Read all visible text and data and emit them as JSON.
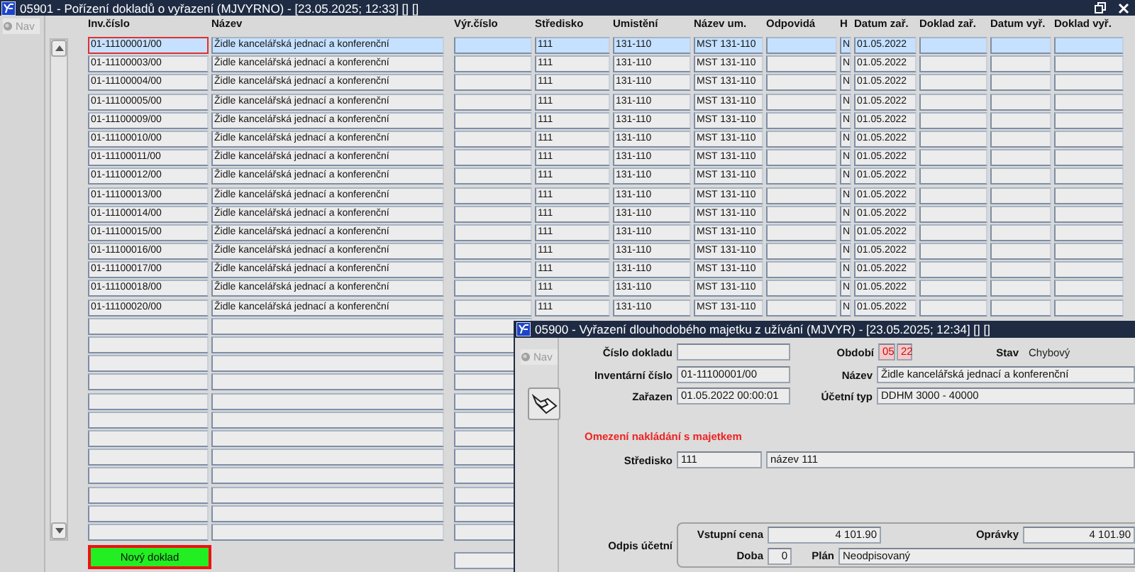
{
  "main_window": {
    "title": "05901 - Pořízení dokladů o vyřazení (MJVYRNO) - [23.05.2025; 12:33] [] []",
    "nav_label": "Nav",
    "columns": [
      "Inv.číslo",
      "Název",
      "Výr.číslo",
      "Středisko",
      "Umistění",
      "Název um.",
      "Odpovidá",
      "H",
      "Datum zař.",
      "Doklad zař.",
      "Datum vyř.",
      "Doklad vyř."
    ],
    "rows": [
      {
        "inv": "01-11100001/00",
        "name": "Židle kancelářská jednací a konferenční",
        "stredisko": "111",
        "umisteni": "131-110",
        "nazev_um": "MST 131-110",
        "h": "N",
        "datum_zar": "01.05.2022",
        "selected": true,
        "focused": true
      },
      {
        "inv": "01-11100003/00",
        "name": "Židle kancelářská jednací a konferenční",
        "stredisko": "111",
        "umisteni": "131-110",
        "nazev_um": "MST 131-110",
        "h": "N",
        "datum_zar": "01.05.2022",
        "selected": false,
        "focused": false
      },
      {
        "inv": "01-11100004/00",
        "name": "Židle kancelářská jednací a konferenční",
        "stredisko": "111",
        "umisteni": "131-110",
        "nazev_um": "MST 131-110",
        "h": "N",
        "datum_zar": "01.05.2022",
        "selected": false,
        "focused": false
      },
      {
        "inv": "01-11100005/00",
        "name": "Židle kancelářská jednací a konferenční",
        "stredisko": "111",
        "umisteni": "131-110",
        "nazev_um": "MST 131-110",
        "h": "N",
        "datum_zar": "01.05.2022",
        "selected": false,
        "focused": false
      },
      {
        "inv": "01-11100009/00",
        "name": "Židle kancelářská jednací a konferenční",
        "stredisko": "111",
        "umisteni": "131-110",
        "nazev_um": "MST 131-110",
        "h": "N",
        "datum_zar": "01.05.2022",
        "selected": false,
        "focused": false
      },
      {
        "inv": "01-11100010/00",
        "name": "Židle kancelářská jednací a konferenční",
        "stredisko": "111",
        "umisteni": "131-110",
        "nazev_um": "MST 131-110",
        "h": "N",
        "datum_zar": "01.05.2022",
        "selected": false,
        "focused": false
      },
      {
        "inv": "01-11100011/00",
        "name": "Židle kancelářská jednací a konferenční",
        "stredisko": "111",
        "umisteni": "131-110",
        "nazev_um": "MST 131-110",
        "h": "N",
        "datum_zar": "01.05.2022",
        "selected": false,
        "focused": false
      },
      {
        "inv": "01-11100012/00",
        "name": "Židle kancelářská jednací a konferenční",
        "stredisko": "111",
        "umisteni": "131-110",
        "nazev_um": "MST 131-110",
        "h": "N",
        "datum_zar": "01.05.2022",
        "selected": false,
        "focused": false
      },
      {
        "inv": "01-11100013/00",
        "name": "Židle kancelářská jednací a konferenční",
        "stredisko": "111",
        "umisteni": "131-110",
        "nazev_um": "MST 131-110",
        "h": "N",
        "datum_zar": "01.05.2022",
        "selected": false,
        "focused": false
      },
      {
        "inv": "01-11100014/00",
        "name": "Židle kancelářská jednací a konferenční",
        "stredisko": "111",
        "umisteni": "131-110",
        "nazev_um": "MST 131-110",
        "h": "N",
        "datum_zar": "01.05.2022",
        "selected": false,
        "focused": false
      },
      {
        "inv": "01-11100015/00",
        "name": "Židle kancelářská jednací a konferenční",
        "stredisko": "111",
        "umisteni": "131-110",
        "nazev_um": "MST 131-110",
        "h": "N",
        "datum_zar": "01.05.2022",
        "selected": false,
        "focused": false
      },
      {
        "inv": "01-11100016/00",
        "name": "Židle kancelářská jednací a konferenční",
        "stredisko": "111",
        "umisteni": "131-110",
        "nazev_um": "MST 131-110",
        "h": "N",
        "datum_zar": "01.05.2022",
        "selected": false,
        "focused": false
      },
      {
        "inv": "01-11100017/00",
        "name": "Židle kancelářská jednací a konferenční",
        "stredisko": "111",
        "umisteni": "131-110",
        "nazev_um": "MST 131-110",
        "h": "N",
        "datum_zar": "01.05.2022",
        "selected": false,
        "focused": false
      },
      {
        "inv": "01-11100018/00",
        "name": "Židle kancelářská jednací a konferenční",
        "stredisko": "111",
        "umisteni": "131-110",
        "nazev_um": "MST 131-110",
        "h": "N",
        "datum_zar": "01.05.2022",
        "selected": false,
        "focused": false
      },
      {
        "inv": "01-11100020/00",
        "name": "Židle kancelářská jednací a konferenční",
        "stredisko": "111",
        "umisteni": "131-110",
        "nazev_um": "MST 131-110",
        "h": "N",
        "datum_zar": "01.05.2022",
        "selected": false,
        "focused": false
      }
    ],
    "new_button": "Nový doklad"
  },
  "detail_window": {
    "title": "05900 - Vyřazení dlouhodobého majetku z užívání (MJVYR) - [23.05.2025; 12:34] [] []",
    "nav_label": "Nav",
    "cislo_dokladu": {
      "label": "Číslo dokladu"
    },
    "obdobi": {
      "label": "Období",
      "month": "05",
      "year": "22"
    },
    "stav": {
      "label": "Stav",
      "value": "Chybový"
    },
    "inventarni_cislo": {
      "label": "Inventární číslo",
      "value": "01-11100001/00"
    },
    "nazev": {
      "label": "Název",
      "value": "Židle kancelářská jednací a konferenční"
    },
    "zarazen": {
      "label": "Zařazen",
      "value": "01.05.2022 00:00:01"
    },
    "ucetni_typ": {
      "label": "Účetní typ",
      "value": "DDHM 3000 - 40000"
    },
    "warning": "Omezení nakládání s majetkem",
    "stredisko": {
      "label": "Středisko",
      "code": "111",
      "name": "název 111"
    },
    "odpis": {
      "label": "Odpis účetní",
      "vstupni_cena": {
        "label": "Vstupní cena",
        "value": "4 101.90"
      },
      "opravky": {
        "label": "Oprávky",
        "value": "4 101.90"
      },
      "doba": {
        "label": "Doba",
        "value": "0"
      },
      "plan": {
        "label": "Plán",
        "value": "Neodpisovaný"
      }
    }
  }
}
